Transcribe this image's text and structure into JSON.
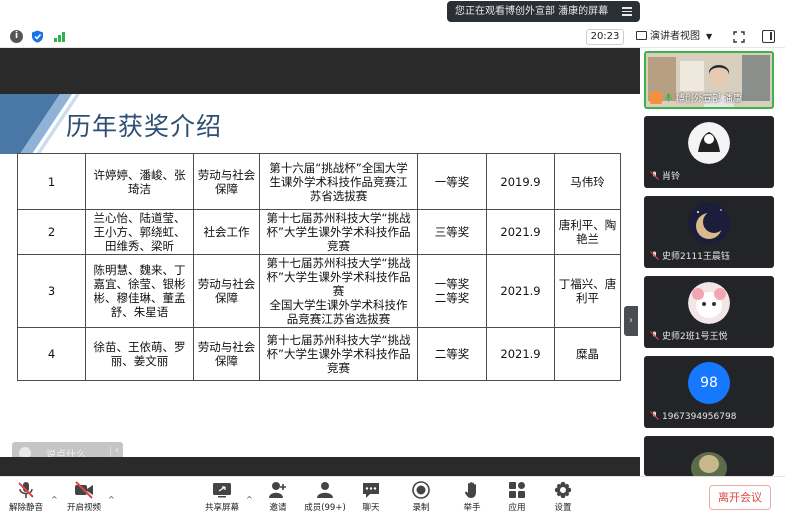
{
  "banner": {
    "share_text": "您正在观看博创外宣部 潘康的屏幕"
  },
  "status_bar": {
    "time": "20:23",
    "presenter_view_label": "演讲者视图"
  },
  "slide": {
    "title": "历年获奖介绍",
    "rows": [
      {
        "no": "1",
        "names": [
          "许婷婷、潘峻、张",
          "琦洁"
        ],
        "category": [
          "劳动与社会",
          "保障"
        ],
        "contest": [
          "第十六届“挑战杯”全国大学",
          "生课外学术科技作品竞赛江",
          "苏省选拔赛"
        ],
        "award": [
          "一等奖"
        ],
        "year": "2019.9",
        "advisor": [
          "马伟玲"
        ]
      },
      {
        "no": "2",
        "names": [
          "兰心怡、陆道莹、",
          "王小方、郭绕虹、",
          "田维秀、梁昕"
        ],
        "category": [
          "社会工作"
        ],
        "contest": [
          "第十七届苏州科技大学“挑战",
          "杯”大学生课外学术科技作品",
          "竞赛"
        ],
        "award": [
          "三等奖"
        ],
        "year": "2021.9",
        "advisor": [
          "唐利平、陶",
          "艳兰"
        ]
      },
      {
        "no": "3",
        "names": [
          "陈明慧、魏来、丁",
          "嘉宜、徐莹、银彬",
          "彬、穆佳琳、董孟",
          "舒、朱星语"
        ],
        "category": [
          "劳动与社会",
          "保障"
        ],
        "contest": [
          "第十七届苏州科技大学“挑战",
          "杯”大学生课外学术科技作品",
          "赛",
          "全国大学生课外学术科技作",
          "品竞赛江苏省选拔赛"
        ],
        "award": [
          "一等奖",
          "二等奖"
        ],
        "year": "2021.9",
        "advisor": [
          "丁福兴、唐",
          "利平"
        ]
      },
      {
        "no": "4",
        "names": [
          "徐苗、王依萌、罗",
          "丽、姜文丽"
        ],
        "category": [
          "劳动与社会",
          "保障"
        ],
        "contest": [
          "第十七届苏州科技大学“挑战",
          "杯”大学生课外学术科技作品",
          "竞赛"
        ],
        "award": [
          "二等奖"
        ],
        "year": "2021.9",
        "advisor": [
          "糜晶"
        ]
      }
    ]
  },
  "chat": {
    "placeholder": "说点什么..."
  },
  "participants": [
    {
      "name": "博创外宣部 潘康"
    },
    {
      "name": "肖铃"
    },
    {
      "name": "史师2111王晨钰"
    },
    {
      "name": "史师2班1号王悦"
    },
    {
      "name": "1967394956798",
      "avatar_text": "98"
    },
    {
      "name": ""
    }
  ],
  "toolbar": {
    "unmute": "解除静音",
    "video": "开启视频",
    "share": "共享屏幕",
    "invite": "邀请",
    "members": "成员(99+)",
    "chat": "聊天",
    "record": "录制",
    "raise_hand": "举手",
    "apps": "应用",
    "settings": "设置",
    "leave": "离开会议"
  },
  "colors": {
    "accent_green": "#3fb24b",
    "leave_red": "#e04545",
    "avatar_blue": "#1677ff",
    "slide_title": "#2e4f73"
  }
}
